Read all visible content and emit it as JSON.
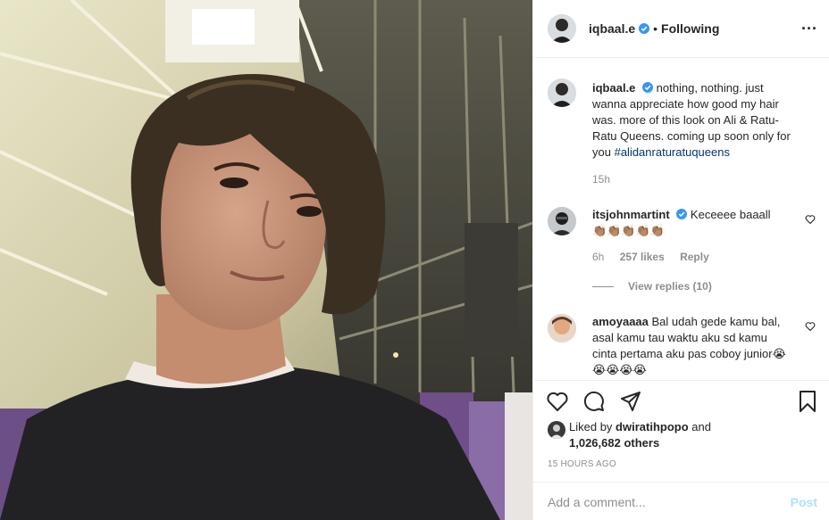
{
  "header": {
    "username": "iqbaal.e",
    "separator": "•",
    "follow_status": "Following",
    "more_label": "..."
  },
  "caption": {
    "username": "iqbaal.e",
    "text": "nothing, nothing. just wanna appreciate how good my hair was. more of this look on Ali & Ratu-Ratu Queens. coming up soon only for you",
    "hashtag": "#alidanraturatuqueens",
    "age": "15h"
  },
  "comments": [
    {
      "username": "itsjohnmartint",
      "text": "Keceeee baaall",
      "emoji": "👏🏽👏🏽👏🏽👏🏽👏🏽",
      "age": "6h",
      "likes": "257 likes",
      "reply_label": "Reply",
      "view_replies": "View replies (10)"
    },
    {
      "username": "amoyaaaa",
      "text": "Bal udah gede kamu bal, asal kamu tau waktu aku sd kamu cinta pertama aku pas coboy junior",
      "emoji": "😭😭😭😭😭"
    }
  ],
  "likes": {
    "prefix": "Liked by",
    "user": "dwiratihpopo",
    "joiner": "and",
    "others": "1,026,682 others"
  },
  "timestamp": "15 HOURS AGO",
  "add_comment": {
    "placeholder": "Add a comment...",
    "post_label": "Post"
  },
  "icons": {
    "verified": "verified-badge-icon",
    "like": "heart-icon",
    "comment": "comment-icon",
    "share": "share-icon",
    "save": "bookmark-icon"
  },
  "colors": {
    "verified_blue": "#3897f0",
    "link": "#00376b",
    "muted": "#8e8e8e",
    "post_disabled": "#b2dffc"
  }
}
